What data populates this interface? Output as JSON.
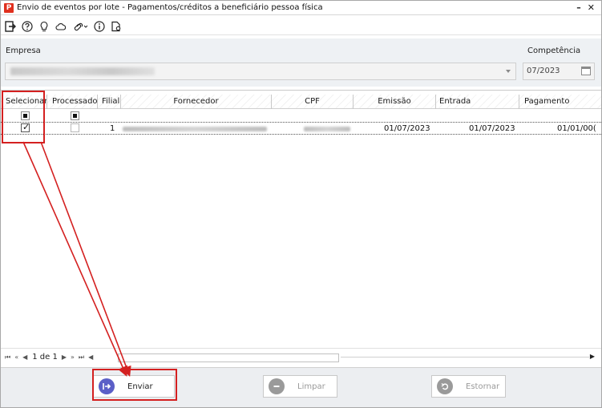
{
  "window": {
    "title": "Envio de eventos por lote - Pagamentos/créditos a beneficiário pessoa física",
    "minimize_glyph": "–",
    "close_glyph": "✕",
    "logo_letter": "P"
  },
  "toolbar": {
    "icons": [
      "exit-icon",
      "help-icon",
      "lightbulb-icon",
      "cloud-icon",
      "link-icon",
      "info-icon",
      "document-icon"
    ]
  },
  "form": {
    "empresa_label": "Empresa",
    "competencia_label": "Competência",
    "competencia_value": "07/2023"
  },
  "grid": {
    "columns": [
      "Selecionar",
      "Processado",
      "Filial",
      "Fornecedor",
      "CPF",
      "Emissão",
      "Entrada",
      "Pagamento"
    ],
    "rows": [
      {
        "selecionar": true,
        "processado": false,
        "filial": "1",
        "emissao": "01/07/2023",
        "entrada": "01/07/2023",
        "pagamento": "01/01/00("
      }
    ]
  },
  "pager": {
    "first": "⏮",
    "prev_fast": "«",
    "prev": "◀",
    "page_text": "1 de 1",
    "next": "▶",
    "next_fast": "»",
    "last": "⏭",
    "scroll_left": "◀",
    "scroll_right": "▶"
  },
  "footer": {
    "enviar_label": "Enviar",
    "limpar_label": "Limpar",
    "estornar_label": "Estornar"
  },
  "colors": {
    "accent_red": "#d42020",
    "enviar_icon": "#5b5fc7",
    "disabled_icon": "#9a9a9a"
  }
}
